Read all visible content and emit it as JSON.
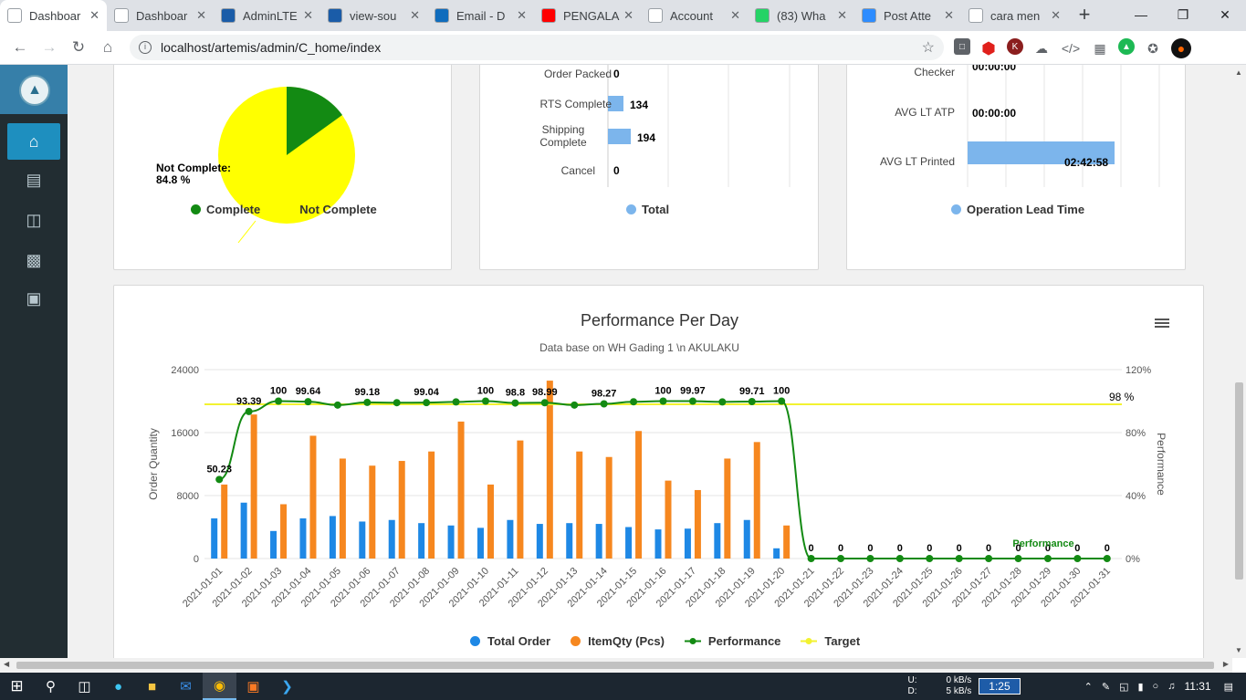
{
  "browser": {
    "tabs": [
      {
        "label": "Dashboar",
        "icon": "artemis-icon",
        "color": "#ffffff",
        "active": true
      },
      {
        "label": "Dashboar",
        "icon": "artemis-icon",
        "color": "#ffffff"
      },
      {
        "label": "AdminLTE",
        "icon": "adminlte-icon",
        "color": "#1a5ca8"
      },
      {
        "label": "view-sou",
        "icon": "adminlte-icon",
        "color": "#1a5ca8"
      },
      {
        "label": "Email - D",
        "icon": "outlook-icon",
        "color": "#0f6cbd"
      },
      {
        "label": "PENGALA",
        "icon": "youtube-icon",
        "color": "#ff0000"
      },
      {
        "label": "Account",
        "icon": "h-icon",
        "color": "#ffffff"
      },
      {
        "label": "(83) Wha",
        "icon": "whatsapp-icon",
        "color": "#25d366"
      },
      {
        "label": "Post Atte",
        "icon": "zoom-icon",
        "color": "#2d8cff"
      },
      {
        "label": "cara men",
        "icon": "google-icon",
        "color": "#ffffff"
      }
    ],
    "url": "localhost/artemis/admin/C_home/index"
  },
  "top_cards": {
    "pie": {
      "annotation_line1": "Not Complete:",
      "annotation_line2": "84.8 %",
      "legend": [
        {
          "label": "Complete",
          "color": "#138a13"
        },
        {
          "label": "Not Complete",
          "color": "#ffff00"
        }
      ]
    },
    "status_bar": {
      "rows": [
        {
          "label": "Order Packed",
          "value": "0"
        },
        {
          "label": "RTS Complete",
          "value": "134"
        },
        {
          "label": "Shipping Complete",
          "value": "194"
        },
        {
          "label": "Cancel",
          "value": "0"
        }
      ],
      "legend": "Total"
    },
    "lead_time": {
      "rows": [
        {
          "label": "Checker",
          "value": "00:00:00"
        },
        {
          "label": "AVG LT ATP",
          "value": "00:00:00"
        },
        {
          "label": "AVG LT Printed",
          "value": "02:42:58"
        }
      ],
      "legend": "Operation Lead Time"
    }
  },
  "chart_data": {
    "type": "bar",
    "title": "Performance Per Day",
    "subtitle": "Data base on WH Gading 1 \\n AKULAKU",
    "ylabel": "Order Quantity",
    "y2label": "Performance",
    "ylim": [
      0,
      24000
    ],
    "y2lim": [
      0,
      120
    ],
    "yticks": [
      "24000",
      "16000",
      "8000",
      "0"
    ],
    "y2ticks": [
      "120%",
      "80%",
      "40%",
      "0%"
    ],
    "target_label": "98 %",
    "target_value": 98,
    "categories": [
      "2021-01-01",
      "2021-01-02",
      "2021-01-03",
      "2021-01-04",
      "2021-01-05",
      "2021-01-06",
      "2021-01-07",
      "2021-01-08",
      "2021-01-09",
      "2021-01-10",
      "2021-01-11",
      "2021-01-12",
      "2021-01-13",
      "2021-01-14",
      "2021-01-15",
      "2021-01-16",
      "2021-01-17",
      "2021-01-18",
      "2021-01-19",
      "2021-01-20",
      "2021-01-21",
      "2021-01-22",
      "2021-01-23",
      "2021-01-24",
      "2021-01-25",
      "2021-01-26",
      "2021-01-27",
      "2021-01-28",
      "2021-01-29",
      "2021-01-30",
      "2021-01-31"
    ],
    "series": [
      {
        "name": "Total Order",
        "color": "#1e88e5",
        "values": [
          5100,
          7100,
          3500,
          5100,
          5400,
          4700,
          4900,
          4500,
          4200,
          3900,
          4900,
          4400,
          4500,
          4400,
          4000,
          3700,
          3800,
          4500,
          4900,
          1300,
          0,
          0,
          0,
          0,
          0,
          0,
          0,
          0,
          0,
          0,
          0
        ]
      },
      {
        "name": "ItemQty (Pcs)",
        "color": "#f6871f",
        "values": [
          9400,
          18300,
          6900,
          15600,
          12700,
          11800,
          12400,
          13600,
          17400,
          9400,
          15000,
          22600,
          13600,
          12900,
          16200,
          9900,
          8700,
          12700,
          14800,
          4200,
          0,
          0,
          0,
          0,
          0,
          0,
          0,
          0,
          0,
          0,
          0
        ]
      },
      {
        "name": "Performance",
        "color": "#138a13",
        "values": [
          50.23,
          93.39,
          100,
          99.64,
          97.5,
          99.18,
          99.0,
          99.04,
          99.5,
          100,
          98.8,
          98.99,
          97.5,
          98.27,
          99.6,
          100,
          99.97,
          99.5,
          99.71,
          100,
          0,
          0,
          0,
          0,
          0,
          0,
          0,
          0,
          0,
          0,
          0
        ],
        "labels": [
          "50.23",
          "93.39",
          "100",
          "99.64",
          "",
          "99.18",
          "",
          "99.04",
          "",
          "100",
          "98.8",
          "98.99",
          "",
          "98.27",
          "",
          "100",
          "99.97",
          "",
          "99.71",
          "100",
          "0",
          "0",
          "0",
          "0",
          "0",
          "0",
          "0",
          "0",
          "0",
          "0",
          "0"
        ]
      },
      {
        "name": "Target",
        "color": "#f2f230"
      }
    ],
    "overlay_label": "Performance"
  },
  "taskbar": {
    "net_up": "U:",
    "net_down": "D:",
    "up_rate": "0 kB/s",
    "down_rate": "5 kB/s",
    "timer": "1:25",
    "clock": "11:31"
  }
}
